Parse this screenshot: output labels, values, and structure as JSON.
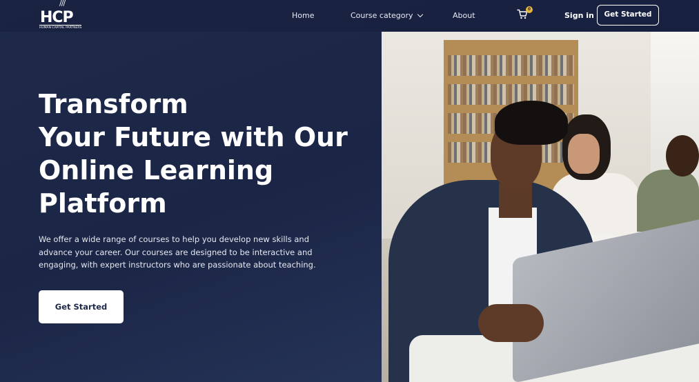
{
  "nav": {
    "logo": {
      "mark": "HCP",
      "tagline": "HUMAN CAPITAL PARTNERS",
      "slashes": "///"
    },
    "links": {
      "home": "Home",
      "course_category": "Course category",
      "about": "About"
    },
    "cart": {
      "icon": "shopping-cart-icon",
      "badge_count": "0"
    },
    "sign_in": "Sign in",
    "get_started": "Get Started"
  },
  "hero": {
    "title_lines": [
      "Transform",
      "Your Future with Our",
      "Online Learning",
      "Platform"
    ],
    "description": "We offer a wide range of courses to help you develop new skills and advance your career. Our courses are designed to be interactive and engaging, with expert instructors who are passionate about teaching.",
    "cta": "Get Started"
  },
  "colors": {
    "background": "#1f2a4a",
    "accent_badge": "#e8b53a",
    "button_bg": "#ffffff",
    "button_text": "#1f2a4a"
  }
}
